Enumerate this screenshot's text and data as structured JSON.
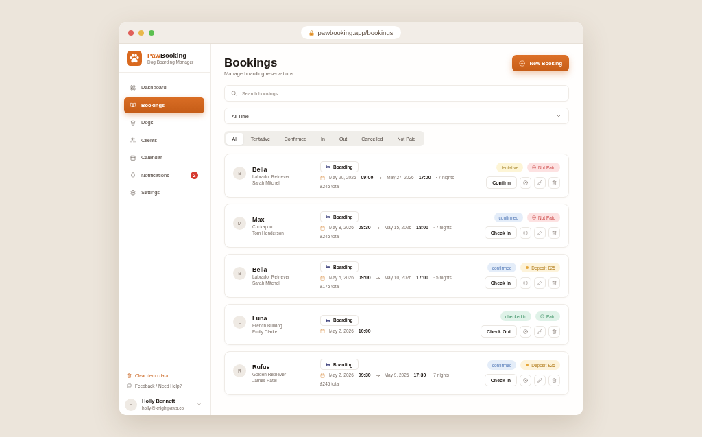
{
  "browser": {
    "url": "pawbooking.app/bookings"
  },
  "sidebar": {
    "brand": {
      "name_lead": "Paw",
      "name_tail": "Booking",
      "tagline": "Dog Boarding Manager"
    },
    "nav": [
      {
        "label": "Dashboard",
        "selected": false
      },
      {
        "label": "Bookings",
        "selected": true
      },
      {
        "label": "Dogs",
        "selected": false
      },
      {
        "label": "Clients",
        "selected": false
      },
      {
        "label": "Calendar",
        "selected": false
      },
      {
        "label": "Notifications",
        "selected": false,
        "badge": "2"
      },
      {
        "label": "Settings",
        "selected": false
      }
    ],
    "links": [
      {
        "label": "Clear demo data",
        "kind": "danger"
      },
      {
        "label": "Feedback / Need Help?",
        "kind": "plain"
      }
    ],
    "user": {
      "initial": "H",
      "name": "Holly Bennett",
      "email": "holly@knightpaws.co"
    }
  },
  "header": {
    "title": "Bookings",
    "subtitle": "Manage boarding reservations",
    "action": "New Booking"
  },
  "search": {
    "placeholder": "Search bookings..."
  },
  "period": {
    "value": "All Time"
  },
  "tabs": [
    {
      "label": "All",
      "selected": true
    },
    {
      "label": "Tentative",
      "selected": false
    },
    {
      "label": "Confirmed",
      "selected": false
    },
    {
      "label": "In",
      "selected": false
    },
    {
      "label": "Out",
      "selected": false
    },
    {
      "label": "Cancelled",
      "selected": false
    },
    {
      "label": "Not Paid",
      "selected": false
    }
  ],
  "bookings": [
    {
      "initial": "B",
      "dog": "Bella",
      "breed": "Labrador Retriever",
      "owner": "Sarah Mitchell",
      "service": "Boarding",
      "start_date": "May 20, 2026",
      "start_time": "09:00",
      "end_date": "May 27, 2026",
      "end_time": "17:00",
      "nights": "· 7 nights",
      "total": "£245 total",
      "status": {
        "label": "tentative",
        "kind": "tentative"
      },
      "payment": {
        "label": "Not Paid",
        "kind": "unpaid"
      },
      "action": "Confirm"
    },
    {
      "initial": "M",
      "dog": "Max",
      "breed": "Cockapoo",
      "owner": "Tom Henderson",
      "service": "Boarding",
      "start_date": "May 8, 2026",
      "start_time": "08:30",
      "end_date": "May 15, 2026",
      "end_time": "18:00",
      "nights": "· 7 nights",
      "total": "£245 total",
      "status": {
        "label": "confirmed",
        "kind": "confirmed"
      },
      "payment": {
        "label": "Not Paid",
        "kind": "unpaid"
      },
      "action": "Check In"
    },
    {
      "initial": "B",
      "dog": "Bella",
      "breed": "Labrador Retriever",
      "owner": "Sarah Mitchell",
      "service": "Boarding",
      "start_date": "May 5, 2026",
      "start_time": "09:00",
      "end_date": "May 10, 2026",
      "end_time": "17:00",
      "nights": "· 5 nights",
      "total": "£175 total",
      "status": {
        "label": "confirmed",
        "kind": "confirmed"
      },
      "payment": {
        "label": "Deposit £25",
        "kind": "deposit"
      },
      "action": "Check In"
    },
    {
      "initial": "L",
      "dog": "Luna",
      "breed": "French Bulldog",
      "owner": "Emily Clarke",
      "service": "Boarding",
      "start_date": "May 2, 2026",
      "start_time": "10:00",
      "status": {
        "label": "checked in",
        "kind": "checkedin"
      },
      "payment": {
        "label": "Paid",
        "kind": "paid"
      },
      "action": "Check Out"
    },
    {
      "initial": "R",
      "dog": "Rufus",
      "breed": "Golden Retriever",
      "owner": "James Patel",
      "service": "Boarding",
      "start_date": "May 2, 2026",
      "start_time": "09:30",
      "end_date": "May 9, 2026",
      "end_time": "17:30",
      "nights": "· 7 nights",
      "total": "£245 total",
      "status": {
        "label": "confirmed",
        "kind": "confirmed"
      },
      "payment": {
        "label": "Deposit £25",
        "kind": "deposit"
      },
      "action": "Check In"
    }
  ]
}
